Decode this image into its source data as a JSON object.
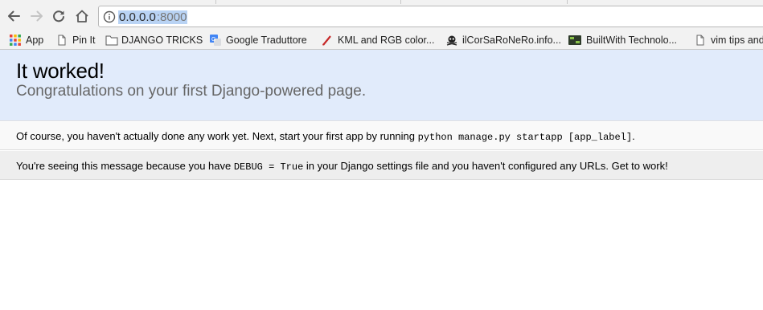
{
  "browser": {
    "address_bar": {
      "host": "0.0.0.0",
      "port": ":8000"
    },
    "bookmarks": [
      {
        "label": "App",
        "icon": "apps-grid-icon"
      },
      {
        "label": "Pin It",
        "icon": "page-icon"
      },
      {
        "label": "DJANGO TRICKS",
        "icon": "folder-icon"
      },
      {
        "label": "Google Traduttore",
        "icon": "translate-icon"
      },
      {
        "label": "KML and RGB color...",
        "icon": "pen-icon"
      },
      {
        "label": "ilCorSaRoNeRo.info...",
        "icon": "skull-icon"
      },
      {
        "label": "BuiltWith Technolo...",
        "icon": "builtwith-icon"
      },
      {
        "label": "vim tips and",
        "icon": "page-icon"
      }
    ]
  },
  "page": {
    "title": "It worked!",
    "subtitle": "Congratulations on your first Django-powered page.",
    "instructions": {
      "text": "Of course, you haven't actually done any work yet. Next, start your first app by running ",
      "code": "python manage.py startapp [app_label]",
      "suffix": "."
    },
    "explanation": {
      "text1": "You're seeing this message because you have ",
      "code": "DEBUG = True",
      "text2": " in your Django settings file and you haven't configured any URLs. Get to work!"
    }
  },
  "colors": {
    "summary_bg": "#e1ebfb",
    "instructions_bg": "#f9f9f9",
    "explanation_bg": "#eeeeee",
    "url_selection": "#b9d3f4"
  }
}
